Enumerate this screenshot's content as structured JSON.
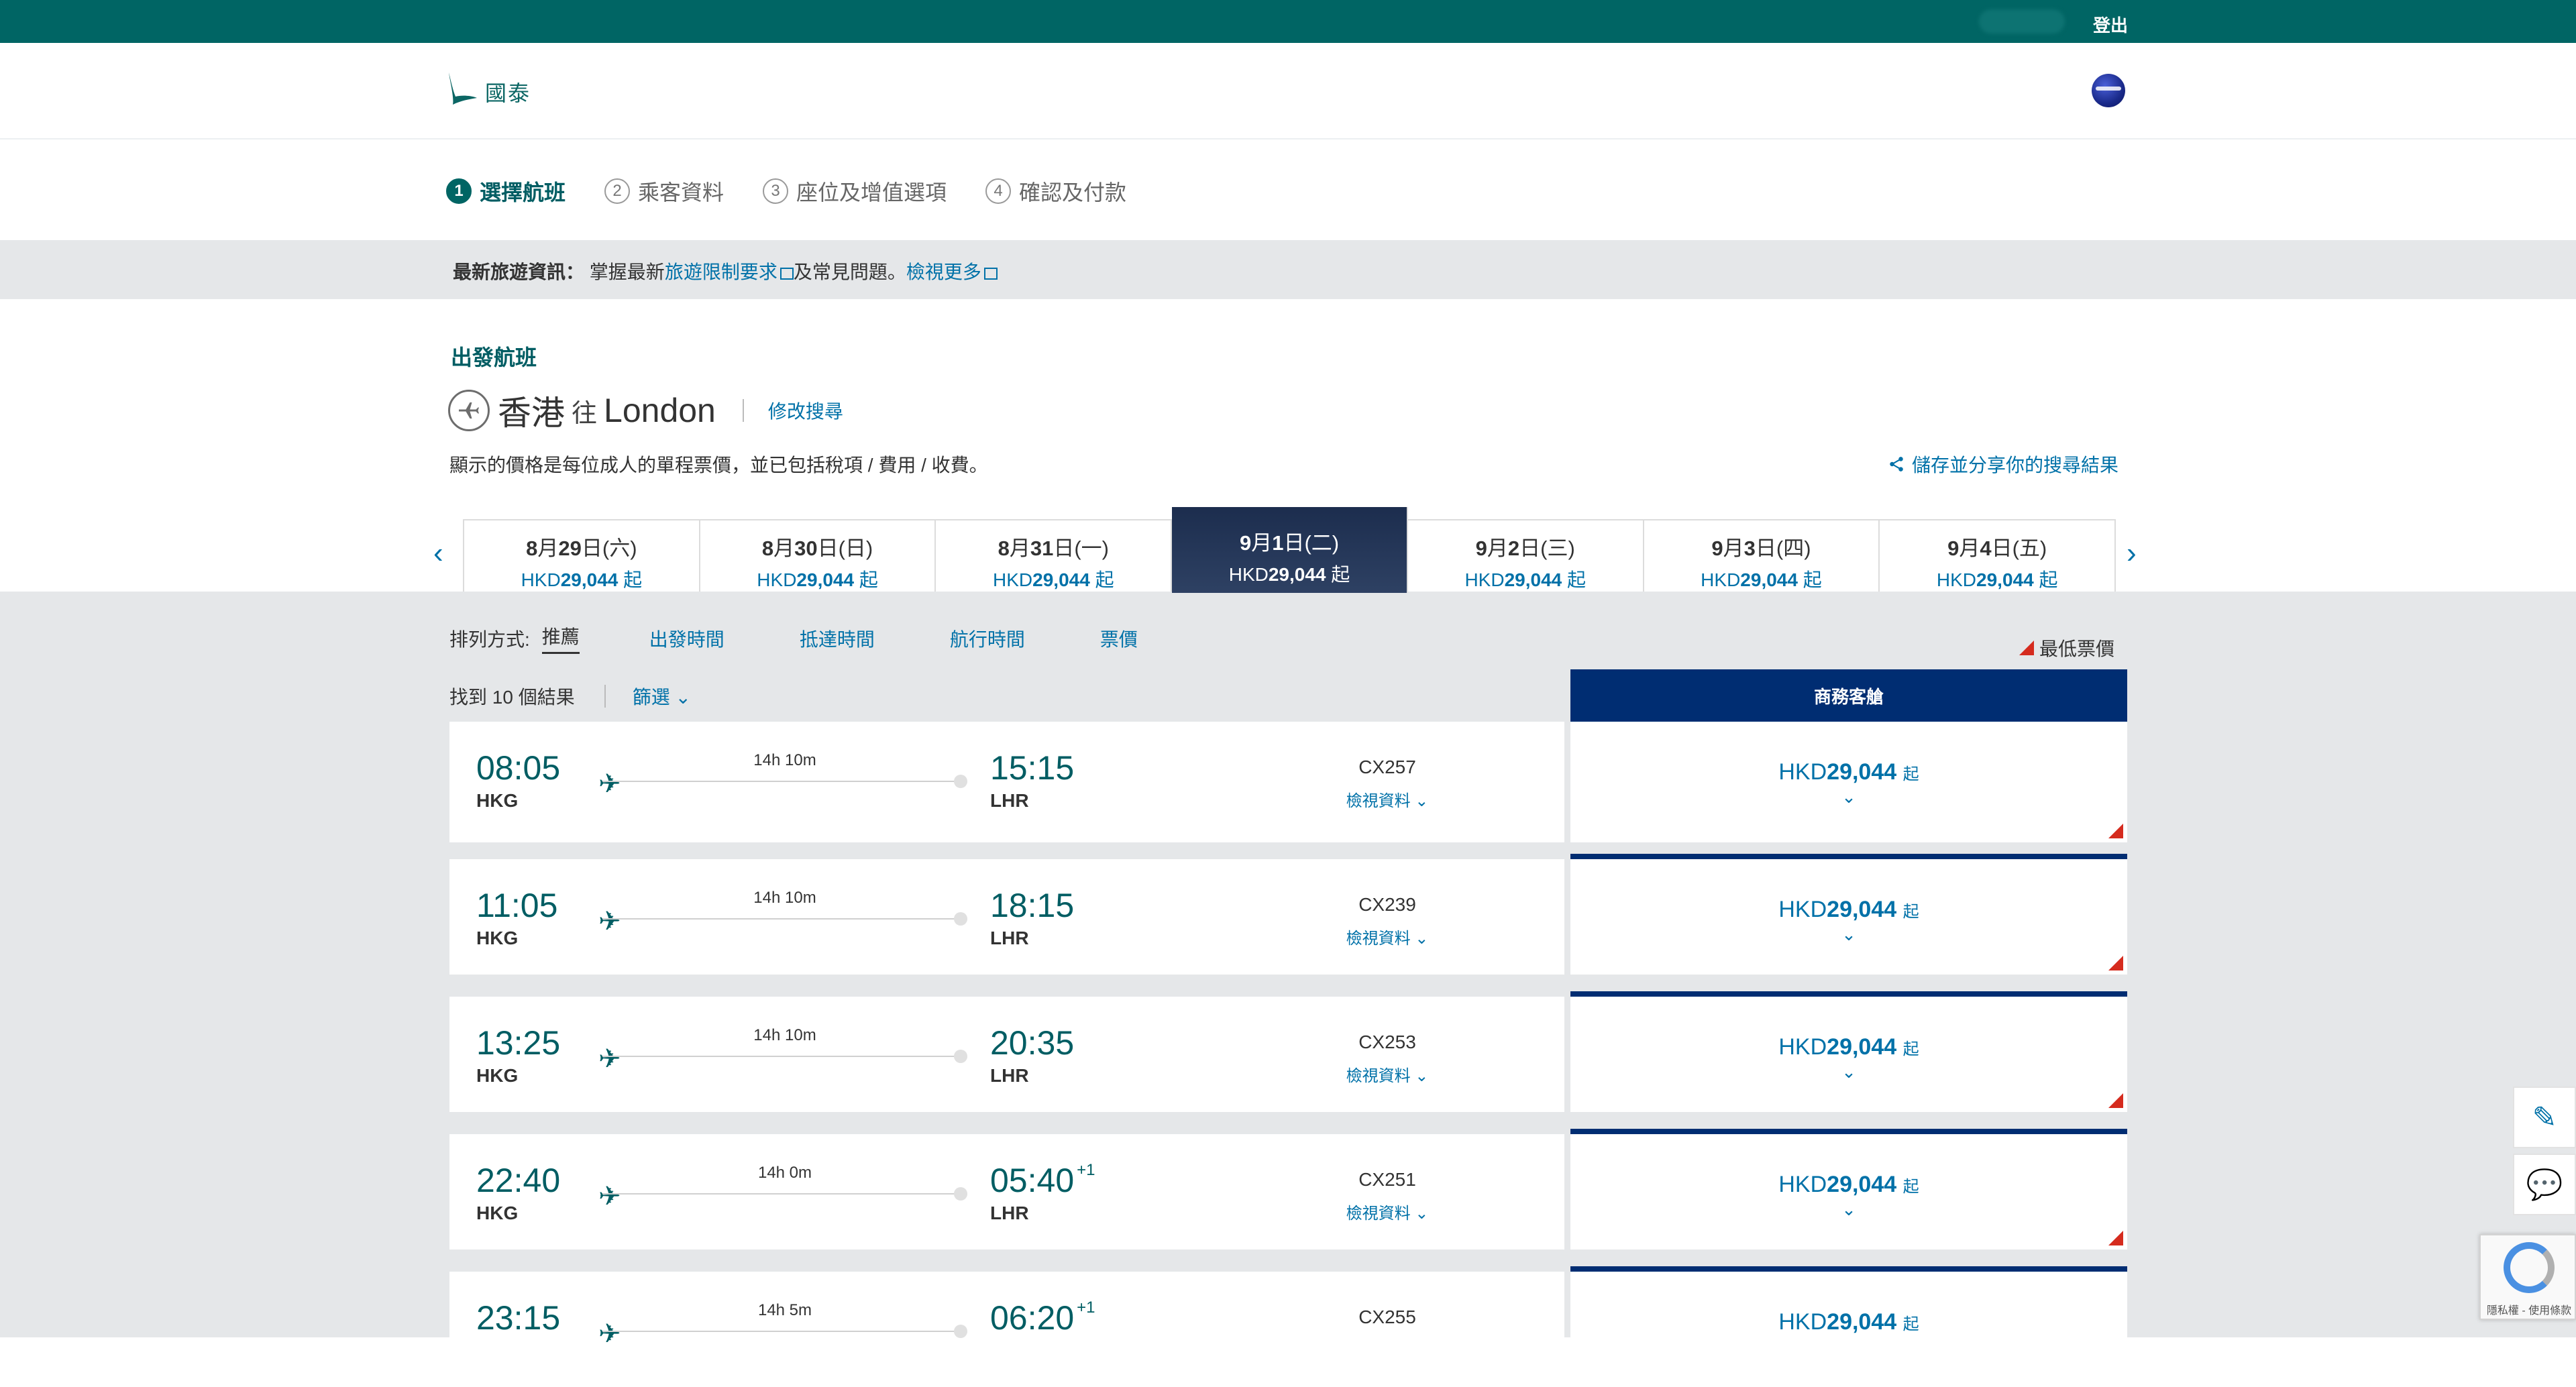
{
  "topbar": {
    "logout": "登出"
  },
  "header": {
    "brand": "國泰",
    "logo_icon": "cathay-brushwing-icon",
    "alliance_icon": "oneworld-icon"
  },
  "steps": [
    {
      "num": "1",
      "label": "選擇航班",
      "active": true
    },
    {
      "num": "2",
      "label": "乘客資料"
    },
    {
      "num": "3",
      "label": "座位及增值選項"
    },
    {
      "num": "4",
      "label": "確認及付款"
    }
  ],
  "notice": {
    "prefix": "最新旅遊資訊：",
    "text1": "掌握最新",
    "link1": "旅遊限制要求",
    "text2": "及常見問題。",
    "link2": "檢視更多"
  },
  "section": {
    "title": "出發航班",
    "from": "香港",
    "to_word": "往",
    "dest": "London",
    "modify": "修改搜尋",
    "note": "顯示的價格是每位成人的單程票價，並已包括稅項 / 費用 / 收費。",
    "share": "儲存並分享你的搜尋結果"
  },
  "dates": [
    {
      "month": "8",
      "day": "29",
      "dow": "(六)",
      "price": "29,044"
    },
    {
      "month": "8",
      "day": "30",
      "dow": "(日)",
      "price": "29,044"
    },
    {
      "month": "8",
      "day": "31",
      "dow": "(一)",
      "price": "29,044"
    },
    {
      "month": "9",
      "day": "1",
      "dow": "(二)",
      "price": "29,044",
      "selected": true
    },
    {
      "month": "9",
      "day": "2",
      "dow": "(三)",
      "price": "29,044"
    },
    {
      "month": "9",
      "day": "3",
      "dow": "(四)",
      "price": "29,044"
    },
    {
      "month": "9",
      "day": "4",
      "dow": "(五)",
      "price": "29,044"
    }
  ],
  "date_labels": {
    "currency": "HKD",
    "from_suffix": "起",
    "month_suffix": "月",
    "day_suffix": "日"
  },
  "sort": {
    "label": "排列方式:",
    "options": [
      "推薦",
      "出發時間",
      "抵達時間",
      "航行時間",
      "票價"
    ],
    "lowest": "最低票價"
  },
  "results": {
    "found": "找到 10 個結果",
    "filter": "篩選",
    "cabin": "商務客艙"
  },
  "flights": [
    {
      "dep": "08:05",
      "dep_code": "HKG",
      "dur": "14h 10m",
      "arr": "15:15",
      "arr_code": "LHR",
      "plus": "",
      "flight": "CX257",
      "view": "檢視資料",
      "currency": "HKD",
      "price": "29,044",
      "from": "起"
    },
    {
      "dep": "11:05",
      "dep_code": "HKG",
      "dur": "14h 10m",
      "arr": "18:15",
      "arr_code": "LHR",
      "plus": "",
      "flight": "CX239",
      "view": "檢視資料",
      "currency": "HKD",
      "price": "29,044",
      "from": "起"
    },
    {
      "dep": "13:25",
      "dep_code": "HKG",
      "dur": "14h 10m",
      "arr": "20:35",
      "arr_code": "LHR",
      "plus": "",
      "flight": "CX253",
      "view": "檢視資料",
      "currency": "HKD",
      "price": "29,044",
      "from": "起"
    },
    {
      "dep": "22:40",
      "dep_code": "HKG",
      "dur": "14h 0m",
      "arr": "05:40",
      "arr_code": "LHR",
      "plus": "+1",
      "flight": "CX251",
      "view": "檢視資料",
      "currency": "HKD",
      "price": "29,044",
      "from": "起"
    },
    {
      "dep": "23:15",
      "dep_code": "",
      "dur": "14h 5m",
      "arr": "06:20",
      "arr_code": "",
      "plus": "+1",
      "flight": "CX255",
      "view": "",
      "currency": "HKD",
      "price": "29,044",
      "from": "起"
    }
  ],
  "recaptcha": {
    "terms": "隱私權 - 使用條款"
  },
  "colors": {
    "brand": "#006564",
    "link": "#0071a8",
    "navy": "#002d72",
    "lowest": "#d52b1e"
  }
}
